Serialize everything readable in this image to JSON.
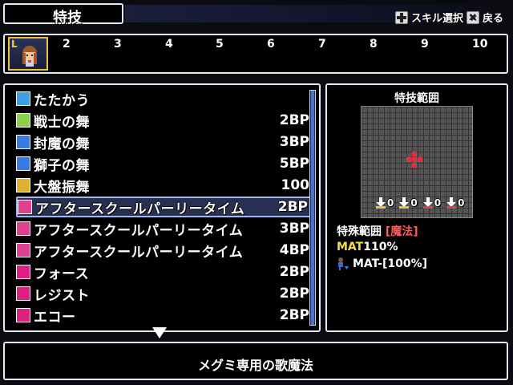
{
  "header": {
    "title": "特技",
    "hint_skill_select": "スキル選択",
    "hint_back": "戻る",
    "dpad_icon": "dpad-icon",
    "x_button_icon": "x-button-icon"
  },
  "party": {
    "leader_marker": "L",
    "slots": [
      "2",
      "3",
      "4",
      "5",
      "6",
      "7",
      "8",
      "9",
      "10"
    ]
  },
  "skills": [
    {
      "name": "たたかう",
      "cost": "",
      "icon": "sword-icon",
      "icon_color": "#3aa0e0"
    },
    {
      "name": "戦士の舞",
      "cost": "2BP",
      "icon": "plus-icon",
      "icon_color": "#8ad048"
    },
    {
      "name": "封魔の舞",
      "cost": "3BP",
      "icon": "square-icon",
      "icon_color": "#3a7ae0"
    },
    {
      "name": "獅子の舞",
      "cost": "5BP",
      "icon": "square-icon",
      "icon_color": "#3a7ae0"
    },
    {
      "name": "大盤振舞",
      "cost": "100",
      "icon": "dice-icon",
      "icon_color": "#e0b030"
    },
    {
      "name": "アフタースクールパーリータイム",
      "cost": "2BP",
      "icon": "music-note-icon",
      "icon_color": "#e04090"
    },
    {
      "name": "アフタースクールパーリータイム",
      "cost": "3BP",
      "icon": "music-plus1-icon",
      "icon_color": "#e04090"
    },
    {
      "name": "アフタースクールパーリータイム",
      "cost": "4BP",
      "icon": "music-plus2-icon",
      "icon_color": "#e04090"
    },
    {
      "name": "フォース",
      "cost": "2BP",
      "icon": "voice-icon",
      "icon_color": "#e02080"
    },
    {
      "name": "レジスト",
      "cost": "2BP",
      "icon": "voice-icon",
      "icon_color": "#e02080"
    },
    {
      "name": "エコー",
      "cost": "2BP",
      "icon": "voice-icon",
      "icon_color": "#e02080"
    }
  ],
  "selected_index": 5,
  "range": {
    "title": "特技範囲",
    "counters": [
      "0",
      "0",
      "0",
      "0"
    ],
    "counter_colors": [
      "#f0c040",
      "#f0c040",
      "#e04050",
      "#e04050"
    ],
    "special_label": "特殊範囲",
    "special_tag": "[魔法]",
    "mat_label": "MAT",
    "mat_value": "110%",
    "debuff": "MAT-[100%]"
  },
  "description": "メグミ専用の歌魔法",
  "colors": {
    "selection": "#465a96",
    "range_red": "#e03040",
    "mat_yellow": "#f0e040"
  }
}
